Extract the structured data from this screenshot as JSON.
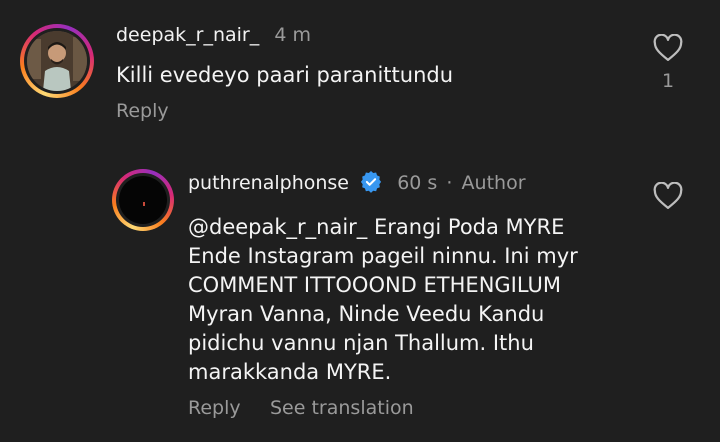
{
  "comment1": {
    "username": "deepak_r_nair_",
    "time": "4 m",
    "text": "Killi evedeyo paari paranittundu",
    "reply_label": "Reply",
    "likes": "1"
  },
  "comment2": {
    "username": "puthrenalphonse",
    "time": "60 s",
    "separator": "·",
    "author_label": "Author",
    "text": "@deepak_r_nair_ Erangi Poda MYRE\nEnde Instagram pageil ninnu. Ini myr\nCOMMENT ITTOOOND ETHENGILUM\nMyran Vanna, Ninde Veedu Kandu\npidichu vannu njan Thallum. Ithu\nmarakkanda MYRE.",
    "reply_label": "Reply",
    "translate_label": "See translation"
  },
  "icons": {
    "like1": "heart-outline-icon",
    "like2": "heart-outline-icon",
    "verified": "verified-badge-icon"
  },
  "colors": {
    "background": "#1f1f1f",
    "secondary_text": "#9a9a9a",
    "verified_blue": "#3897f0"
  }
}
